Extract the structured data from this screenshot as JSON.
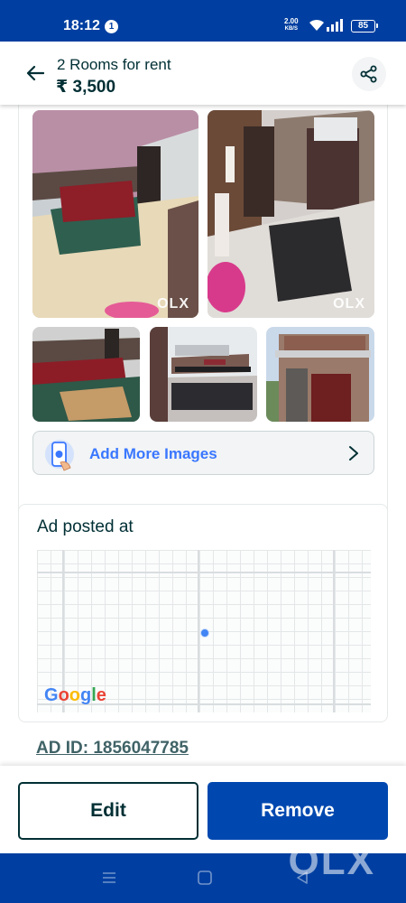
{
  "status_bar": {
    "time": "18:12",
    "notification_count": "1",
    "net_speed_value": "2.00",
    "net_speed_unit": "KB/S",
    "battery": "85"
  },
  "header": {
    "title": "2 Rooms for rent",
    "price": "₹ 3,500"
  },
  "images": {
    "watermark": "OLX",
    "add_more_label": "Add More Images"
  },
  "map": {
    "title": "Ad posted at",
    "provider": "Google"
  },
  "ad_id": "AD ID: 1856047785",
  "actions": {
    "edit_label": "Edit",
    "remove_label": "Remove"
  },
  "nav": {
    "watermark": "OLX"
  },
  "colors": {
    "brand_blue": "#003fa1",
    "button_blue": "#0048b0",
    "dark_teal": "#002f34",
    "link_blue": "#3a77ff"
  }
}
